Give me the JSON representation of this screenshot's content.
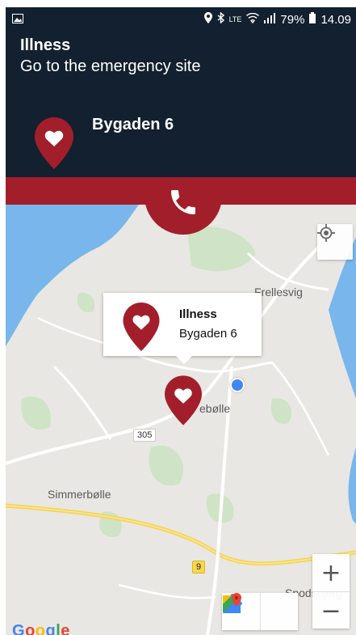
{
  "status_bar": {
    "battery": "79%",
    "time": "14.09",
    "lte_label": "LTE"
  },
  "header": {
    "type": "Illness",
    "instruction": "Go to the emergency site",
    "address": "Bygaden 6"
  },
  "map": {
    "labels": {
      "frellesvig": "Frellesvig",
      "ebolle": "ebølle",
      "simmerbolle": "Simmerbølle",
      "spodsbjerg": "Spodsbjerg"
    },
    "road_badges": {
      "r305": "305",
      "r9": "9"
    },
    "info_window": {
      "title": "Illness",
      "address": "Bygaden 6"
    },
    "zoom_in_label": "+",
    "zoom_out_label": "−",
    "logo": {
      "G": "G",
      "o1": "o",
      "o2": "o",
      "g": "g",
      "l": "l",
      "e": "e"
    }
  },
  "colors": {
    "header_bg": "#12202f",
    "accent_red": "#a31e2b",
    "water": "#78b6ec",
    "my_location": "#4285f4"
  },
  "icons": [
    "image-icon",
    "location-icon",
    "bluetooth-icon",
    "wifi-icon",
    "signal-icon",
    "battery-icon",
    "heart-pin-icon",
    "phone-icon",
    "my-location-icon",
    "directions-icon",
    "google-maps-icon"
  ]
}
